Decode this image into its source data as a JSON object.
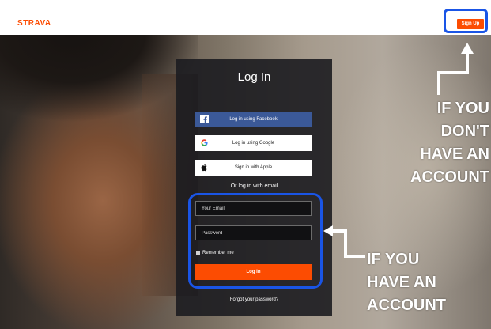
{
  "topbar": {
    "brand": "STRAVA",
    "signup_label": "Sign Up"
  },
  "login": {
    "title": "Log In",
    "facebook_label": "Log in using Facebook",
    "google_label": "Log in using Google",
    "apple_label": "Sign in with Apple",
    "or_text": "Or log in with email",
    "email_placeholder": "Your Email",
    "password_placeholder": "Password",
    "remember_label": "Remember me",
    "login_button_label": "Log In",
    "forgot_label": "Forgot your password?"
  },
  "annotations": {
    "no_account": [
      "IF YOU",
      "DON'T",
      "HAVE AN",
      "ACCOUNT"
    ],
    "have_account": [
      "IF YOU",
      "HAVE AN",
      "ACCOUNT"
    ]
  },
  "colors": {
    "brand": "#fc4c02",
    "highlight": "#1a55e6",
    "facebook": "#3b5998"
  },
  "icons": {
    "facebook": "facebook-icon",
    "google": "google-icon",
    "apple": "apple-icon"
  }
}
